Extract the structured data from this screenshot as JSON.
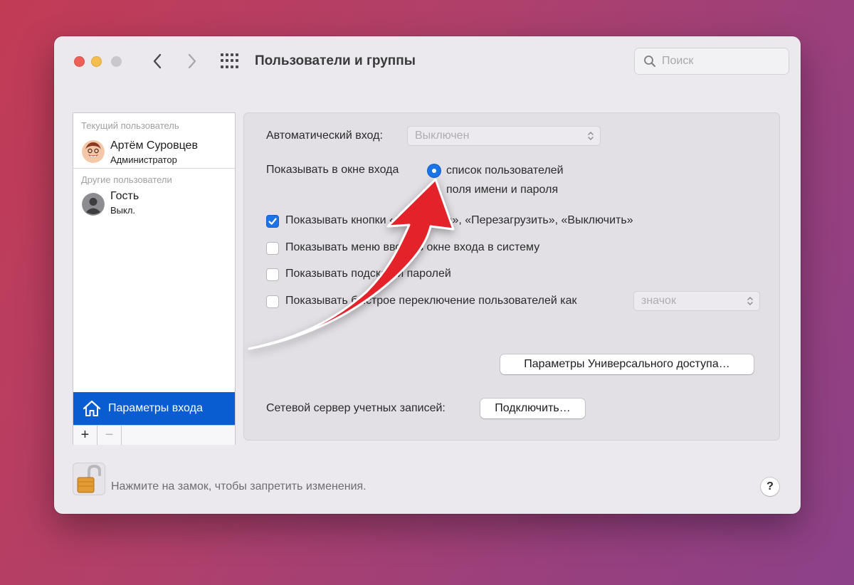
{
  "window": {
    "title": "Пользователи и группы",
    "search_placeholder": "Поиск"
  },
  "sidebar": {
    "current_section": "Текущий пользователь",
    "current_user": {
      "name": "Артём Суровцев",
      "role": "Администратор"
    },
    "other_section": "Другие пользователи",
    "other_user": {
      "name": "Гость",
      "role": "Выкл."
    },
    "login_options": "Параметры входа",
    "add": "+",
    "remove": "−"
  },
  "panel": {
    "auto_login_label": "Автоматический вход:",
    "auto_login_value": "Выключен",
    "show_in_login_label": "Показывать в окне входа",
    "radio_options": [
      {
        "label": "список пользователей",
        "selected": true
      },
      {
        "label": "поля имени и пароля",
        "selected": false
      }
    ],
    "checkboxes": [
      {
        "label": "Показывать кнопки «Режим сна», «Перезагрузить», «Выключить»",
        "checked": true
      },
      {
        "label": "Показывать меню ввода в окне входа в систему",
        "checked": false
      },
      {
        "label": "Показывать подсказки паролей",
        "checked": false
      },
      {
        "label": "Показывать быстрое переключение пользователей как",
        "checked": false
      }
    ],
    "fast_switch_value": "значок",
    "accessibility_button": "Параметры Универсального доступа…",
    "network_server_label": "Сетевой сервер учетных записей:",
    "connect_button": "Подключить…"
  },
  "footer": {
    "lock_text": "Нажмите на замок, чтобы запретить изменения.",
    "help": "?"
  },
  "colors": {
    "accent": "#1a73e8",
    "selection": "#0a5dd0",
    "arrow": "#e3202a"
  }
}
